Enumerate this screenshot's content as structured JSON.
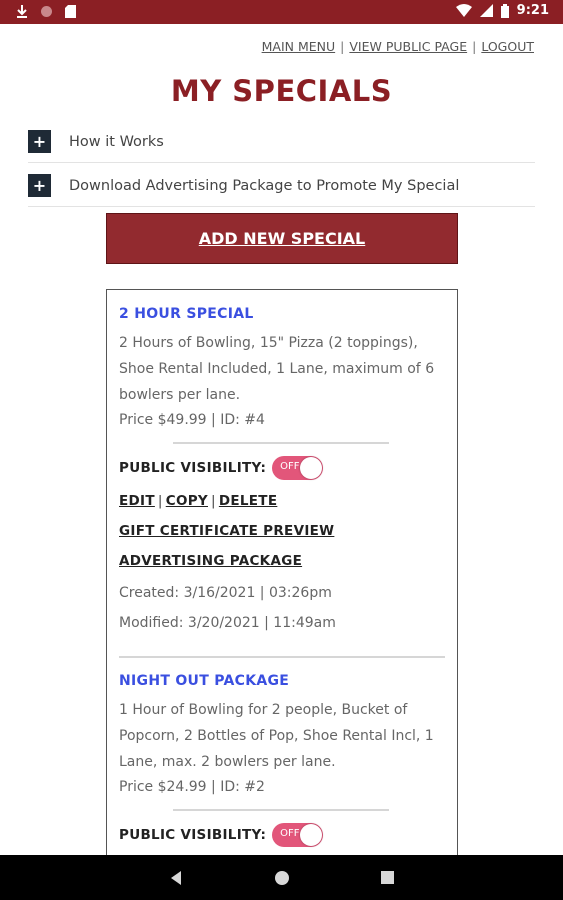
{
  "status_bar": {
    "time": "9:21",
    "left_icons": [
      "download-icon",
      "circle-icon",
      "sd-card-icon"
    ],
    "right_icons": [
      "wifi-icon",
      "signal-icon",
      "battery-icon"
    ]
  },
  "top_links": {
    "main_menu": "MAIN MENU",
    "view_public_page": "VIEW PUBLIC PAGE",
    "logout": "LOGOUT",
    "separator": "|"
  },
  "page_title": "MY SPECIALS",
  "accordions": [
    {
      "label": "How it Works",
      "icon": "+"
    },
    {
      "label": "Download Advertising Package to Promote My Special",
      "icon": "+"
    }
  ],
  "add_button": "ADD NEW SPECIAL",
  "specials": [
    {
      "title": "2 HOUR SPECIAL",
      "description": "2 Hours of Bowling, 15\" Pizza (2 toppings), Shoe Rental Included, 1 Lane, maximum of 6 bowlers per lane.",
      "price_id": "Price $49.99 | ID: #4",
      "visibility_label": "PUBLIC VISIBILITY:",
      "toggle_text": "OFF",
      "edit": "EDIT",
      "copy": "COPY",
      "delete": "DELETE",
      "separator": "|",
      "gift_preview": "GIFT CERTIFICATE PREVIEW",
      "advertising": "ADVERTISING PACKAGE",
      "created": "Created: 3/16/2021 | 03:26pm",
      "modified": "Modified: 3/20/2021 | 11:49am"
    },
    {
      "title": "NIGHT OUT PACKAGE",
      "description": "1 Hour of Bowling for 2 people, Bucket of Popcorn, 2 Bottles of Pop, Shoe Rental Incl, 1 Lane, max. 2 bowlers per lane.",
      "price_id": "Price $24.99 | ID: #2",
      "visibility_label": "PUBLIC VISIBILITY:",
      "toggle_text": "OFF"
    }
  ],
  "colors": {
    "brand": "#8b1f24",
    "button": "#922a2f",
    "title_blue": "#3a4fe0",
    "toggle_pink": "#e2567a"
  },
  "nav_bar": [
    "back-icon",
    "home-icon",
    "recents-icon"
  ]
}
